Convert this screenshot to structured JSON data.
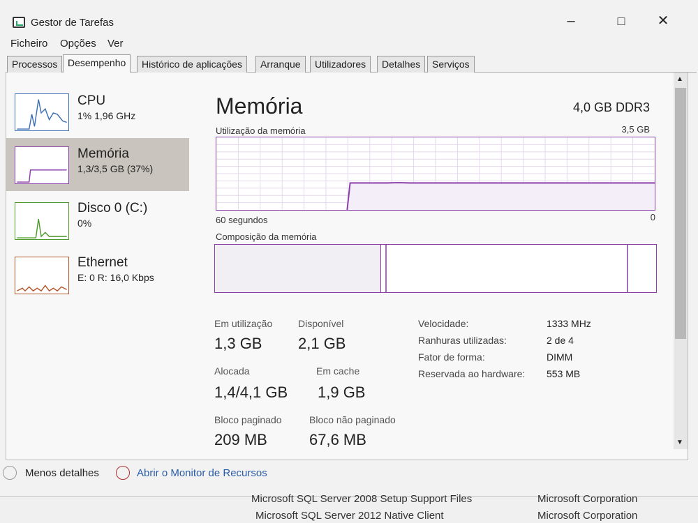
{
  "window": {
    "title": "Gestor de Tarefas"
  },
  "menu": [
    "Ficheiro",
    "Opções",
    "Ver"
  ],
  "tabs": [
    "Processos",
    "Desempenho",
    "Histórico de aplicações",
    "Arranque",
    "Utilizadores",
    "Detalhes",
    "Serviços"
  ],
  "active_tab": "Desempenho",
  "sidebar": {
    "items": [
      {
        "name": "CPU",
        "sub": "1% 1,96 GHz",
        "color": "#3c6fb5"
      },
      {
        "name": "Memória",
        "sub": "1,3/3,5 GB (37%)",
        "color": "#8a3fa8"
      },
      {
        "name": "Disco 0 (C:)",
        "sub": "0%",
        "color": "#4d9a2a"
      },
      {
        "name": "Ethernet",
        "sub": "E: 0 R: 16,0 Kbps",
        "color": "#b5562a"
      }
    ],
    "selected_index": 1
  },
  "memory": {
    "title": "Memória",
    "type": "4,0 GB DDR3",
    "usage_label": "Utilização da memória",
    "usage_max": "3,5 GB",
    "time_left": "60 segundos",
    "time_right": "0",
    "composition_label": "Composição da memória",
    "stats": {
      "in_use_label": "Em utilização",
      "in_use": "1,3 GB",
      "available_label": "Disponível",
      "available": "2,1 GB",
      "committed_label": "Alocada",
      "committed": "1,4/4,1 GB",
      "cached_label": "Em cache",
      "cached": "1,9 GB",
      "paged_label": "Bloco paginado",
      "paged": "209 MB",
      "nonpaged_label": "Bloco não paginado",
      "nonpaged": "67,6 MB"
    },
    "details": [
      {
        "key": "Velocidade:",
        "value": "1333 MHz"
      },
      {
        "key": "Ranhuras utilizadas:",
        "value": "2 de 4"
      },
      {
        "key": "Fator de forma:",
        "value": "DIMM"
      },
      {
        "key": "Reservada ao hardware:",
        "value": "553 MB"
      }
    ]
  },
  "footer": {
    "fewer_details": "Menos detalhes",
    "open_monitor": "Abrir o Monitor de Recursos"
  },
  "background_list": [
    {
      "name": "Microsoft SQL Server 2008 Setup Support Files",
      "publisher": "Microsoft Corporation"
    },
    {
      "name": "Microsoft SQL Server 2012 Native Client",
      "publisher": "Microsoft Corporation"
    }
  ],
  "chart_data": {
    "type": "line",
    "title": "Utilização da memória",
    "xlabel": "",
    "ylabel": "",
    "x_ticks": [
      "60 segundos",
      "0"
    ],
    "ylim": [
      0,
      3.5
    ],
    "series": [
      {
        "values": [
          0,
          0,
          0,
          0,
          0,
          0,
          0,
          0,
          0,
          0,
          0,
          0,
          0,
          0,
          0,
          0,
          0,
          0,
          1.3,
          1.3,
          1.3,
          1.3,
          1.3,
          1.3,
          1.31,
          1.31,
          1.3,
          1.3,
          1.3,
          1.3,
          1.3,
          1.3,
          1.3,
          1.3,
          1.3,
          1.3,
          1.3,
          1.3,
          1.3,
          1.3,
          1.3,
          1.3,
          1.3,
          1.3,
          1.3,
          1.3,
          1.3,
          1.3,
          1.3,
          1.3,
          1.3,
          1.3,
          1.3,
          1.3,
          1.3,
          1.3,
          1.3,
          1.3,
          1.3,
          1.3
        ]
      }
    ],
    "grid": true
  }
}
